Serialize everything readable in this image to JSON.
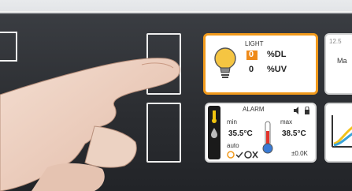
{
  "light_panel": {
    "title": "LIGHT",
    "dl_value": "0",
    "dl_unit": "%DL",
    "uv_value": "0",
    "uv_unit": "%UV"
  },
  "alarm_panel": {
    "title": "ALARM",
    "min_label": "min",
    "min_value": "35.5°C",
    "max_label": "max",
    "max_value": "38.5°C",
    "auto_label": "auto",
    "offset_value": "±0.0K"
  },
  "right_top_panel": {
    "line1": "12.5",
    "line2": "Ma"
  },
  "colors": {
    "light_border": "#f19a1c",
    "bulb": "#f5c542",
    "thermo_blue": "#3a7bd5",
    "thermo_red": "#e2342b",
    "graph_yellow": "#f3c21b",
    "graph_blue": "#3aa3d9"
  }
}
